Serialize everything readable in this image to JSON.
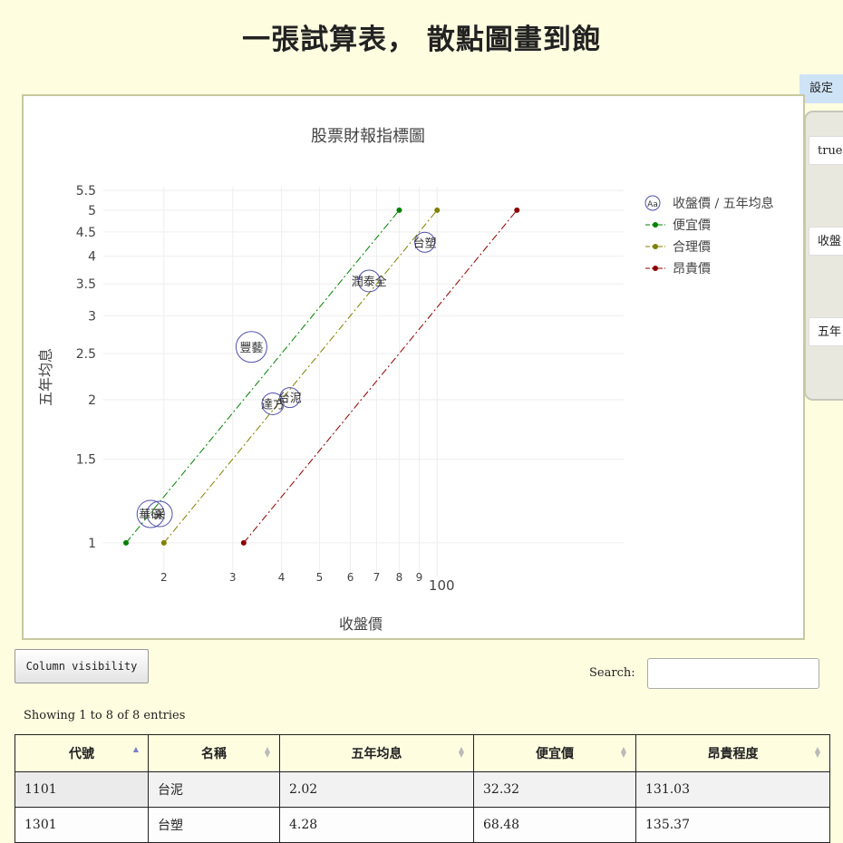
{
  "page": {
    "title": "一張試算表， 散點圖畫到飽"
  },
  "settings": {
    "tab_label": "設定",
    "items": [
      "true",
      "收盤",
      "五年"
    ]
  },
  "controls": {
    "column_visibility_label": "Column visibility",
    "search_label": "Search:",
    "search_value": "",
    "info_text": "Showing 1 to 8 of 8 entries"
  },
  "table": {
    "columns": [
      "代號",
      "名稱",
      "五年均息",
      "便宜價",
      "昂貴程度"
    ],
    "rows": [
      [
        "1101",
        "台泥",
        "2.02",
        "32.32",
        "131.03"
      ],
      [
        "1301",
        "台塑",
        "4.28",
        "68.48",
        "135.37"
      ]
    ]
  },
  "chart_data": {
    "type": "scatter",
    "title": "股票財報指標圖",
    "xlabel": "收盤價",
    "ylabel": "五年均息",
    "x_scale": "log",
    "y_scale": "log",
    "xlim": [
      14,
      300
    ],
    "ylim": [
      0.85,
      5.6
    ],
    "grid": true,
    "legend_position": "right",
    "x_ticks": [
      "2",
      "3",
      "4",
      "5",
      "6",
      "7",
      "8",
      "9",
      "100"
    ],
    "y_ticks": [
      "1",
      "1.5",
      "2",
      "2.5",
      "3",
      "3.5",
      "4",
      "4.5",
      "5",
      "5.5"
    ],
    "colors": {
      "points": "#5050aa",
      "cheap": "#008000",
      "fair": "#808000",
      "expensive": "#8b0000"
    },
    "series": [
      {
        "name": "收盤價 / 五年均息",
        "mode": "text-markers",
        "points": [
          {
            "label": "台泥",
            "x": 42.0,
            "y": 2.02,
            "r": 11
          },
          {
            "label": "台塑",
            "x": 93.0,
            "y": 4.28,
            "r": 11
          },
          {
            "label": "潤泰全",
            "x": 67.0,
            "y": 3.55,
            "r": 12
          },
          {
            "label": "豐藝",
            "x": 33.5,
            "y": 2.58,
            "r": 17
          },
          {
            "label": "達方",
            "x": 38.0,
            "y": 1.96,
            "r": 12
          },
          {
            "label": "華碩",
            "x": 18.5,
            "y": 1.15,
            "r": 15
          },
          {
            "label": "采",
            "x": 19.5,
            "y": 1.15,
            "r": 14
          }
        ]
      },
      {
        "name": "便宜價",
        "mode": "lines+markers",
        "points": [
          {
            "x": 16,
            "y": 1
          },
          {
            "x": 80,
            "y": 5
          }
        ]
      },
      {
        "name": "合理價",
        "mode": "lines+markers",
        "points": [
          {
            "x": 20,
            "y": 1
          },
          {
            "x": 100,
            "y": 5
          }
        ]
      },
      {
        "name": "昂貴價",
        "mode": "lines+markers",
        "points": [
          {
            "x": 32,
            "y": 1
          },
          {
            "x": 160,
            "y": 5
          }
        ]
      }
    ]
  }
}
